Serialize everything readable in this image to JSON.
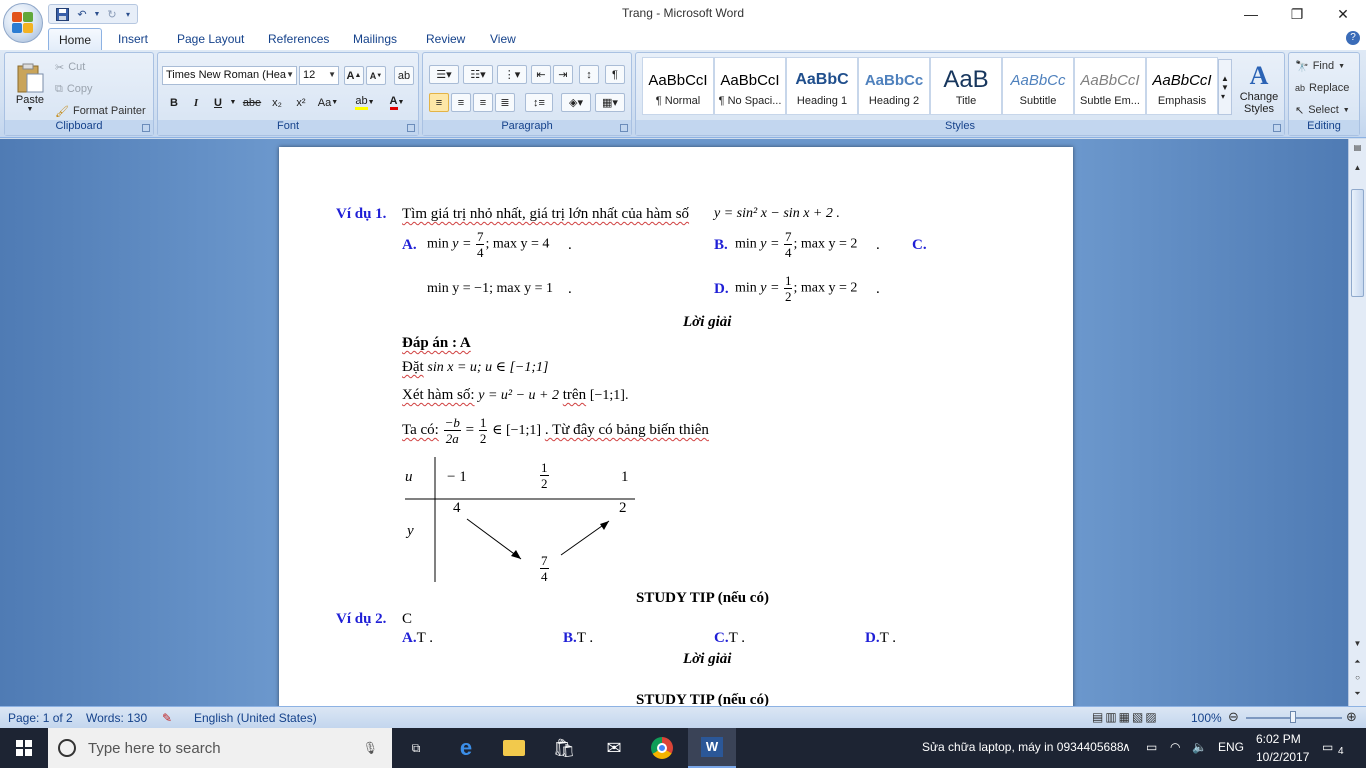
{
  "window": {
    "title": "Trang - Microsoft Word"
  },
  "ribbon_tabs": [
    "Home",
    "Insert",
    "Page Layout",
    "References",
    "Mailings",
    "Review",
    "View"
  ],
  "clipboard": {
    "paste": "Paste",
    "cut": "Cut",
    "copy": "Copy",
    "format_painter": "Format Painter",
    "label": "Clipboard"
  },
  "font": {
    "name": "Times New Roman (Hea",
    "size": "12",
    "label": "Font",
    "bold": "B",
    "italic": "I",
    "underline": "U",
    "strike": "abe",
    "sub": "x₂",
    "sup": "x²",
    "case": "Aa",
    "grow": "A",
    "shrink": "A"
  },
  "paragraph": {
    "label": "Paragraph"
  },
  "styles": {
    "label": "Styles",
    "items": [
      {
        "preview": "AaBbCcI",
        "name": "¶ Normal"
      },
      {
        "preview": "AaBbCcI",
        "name": "¶ No Spaci..."
      },
      {
        "preview": "AaBbC",
        "name": "Heading 1"
      },
      {
        "preview": "AaBbCc",
        "name": "Heading 2"
      },
      {
        "preview": "AaB",
        "name": "Title"
      },
      {
        "preview": "AaBbCc",
        "name": "Subtitle"
      },
      {
        "preview": "AaBbCcI",
        "name": "Subtle Em..."
      },
      {
        "preview": "AaBbCcI",
        "name": "Emphasis"
      }
    ],
    "change_styles": "Change Styles"
  },
  "editing": {
    "find": "Find",
    "replace": "Replace",
    "select": "Select",
    "label": "Editing"
  },
  "document": {
    "ex1_label": "Ví dụ 1.",
    "ex1_text": "Tìm giá trị nhỏ nhất, giá trị lớn nhất của hàm số",
    "ex1_formula": "y = sin² x − sin x + 2 .",
    "opt_a": "A.",
    "opt_b": "B.",
    "opt_c": "C.",
    "opt_d": "D.",
    "min": "min",
    "max": "max",
    "y_eq": "y =",
    "a_num": "7",
    "a_den": "4",
    "a_max": "; max y = 4",
    "b_num": "7",
    "b_den": "4",
    "b_max": "; max y = 2",
    "c_text": "min y = −1; max y = 1",
    "d_num": "1",
    "d_den": "2",
    "d_max": "; max y = 2",
    "dot": ".",
    "loi_giai": "Lời giải",
    "dap_an": "Đáp án : A",
    "dat": "Đặt",
    "dat_formula": "sin x = u; u ∈ [−1;1]",
    "xet": "Xét hàm số:",
    "xet_formula": "y = u² − u + 2",
    "tren": "trên",
    "tren_formula": "[−1;1].",
    "taco": "Ta có:",
    "taco_num": "−b",
    "taco_den": "2a",
    "eq": "=",
    "half_num": "1",
    "half_den": "2",
    "in_interval": "∈ [−1;1]",
    "tu_day": ". Từ đây có bảng biến thiên",
    "table": {
      "u": "u",
      "y": "y",
      "u1": "− 1",
      "u2_num": "1",
      "u2_den": "2",
      "u3": "1",
      "y1": "4",
      "y2_num": "7",
      "y2_den": "4",
      "y3": "2"
    },
    "study_tip": "STUDY TIP (nếu có)",
    "ex2_label": "Ví dụ 2.",
    "ex2_text": "C",
    "ex2_a": "A.",
    "ex2_a_t": "T .",
    "ex2_b": "B.",
    "ex2_b_t": "T .",
    "ex2_c": "C.",
    "ex2_c_t": "T .",
    "ex2_d": "D.",
    "ex2_d_t": "T .",
    "loi_giai2": "Lời giải",
    "study_tip2": "STUDY TIP (nếu có)"
  },
  "status": {
    "page": "Page: 1 of 2",
    "words": "Words: 130",
    "language": "English (United States)",
    "zoom": "100%"
  },
  "taskbar": {
    "search_placeholder": "Type here to search",
    "tray_text": "Sửa chữa laptop, máy in 0934405688",
    "lang": "ENG",
    "time": "6:02 PM",
    "date": "10/2/2017",
    "notif": "4"
  }
}
